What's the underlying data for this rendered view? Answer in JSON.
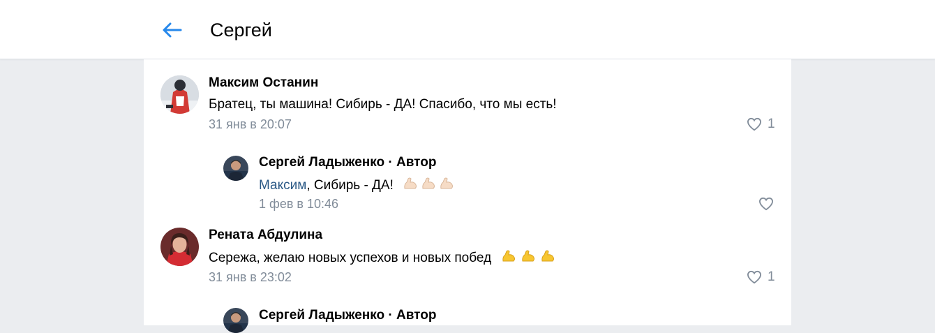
{
  "header": {
    "title": "Сергей",
    "back_icon": "arrow-left-icon"
  },
  "colors": {
    "accent": "#2688eb",
    "meta": "#818c99",
    "background": "#ebedf0"
  },
  "comments": [
    {
      "author": "Максим Останин",
      "text": "Братец, ты машина! Сибирь - ДА! Спасибо, что мы есть!",
      "date": "31 янв в 20:07",
      "likes": "1",
      "reply": {
        "author": "Сергей Ладыженко · Автор",
        "mention": "Максим",
        "text": ", Сибирь - ДА!",
        "emoji_count": 3,
        "date": "1 фев в 10:46",
        "likes": ""
      }
    },
    {
      "author": "Рената Абдулина",
      "text": "Сережа, желаю новых успехов и новых побед",
      "emoji_count": 3,
      "date": "31 янв в 23:02",
      "likes": "1",
      "reply": {
        "author": "Сергей Ладыженко · Автор"
      }
    }
  ]
}
